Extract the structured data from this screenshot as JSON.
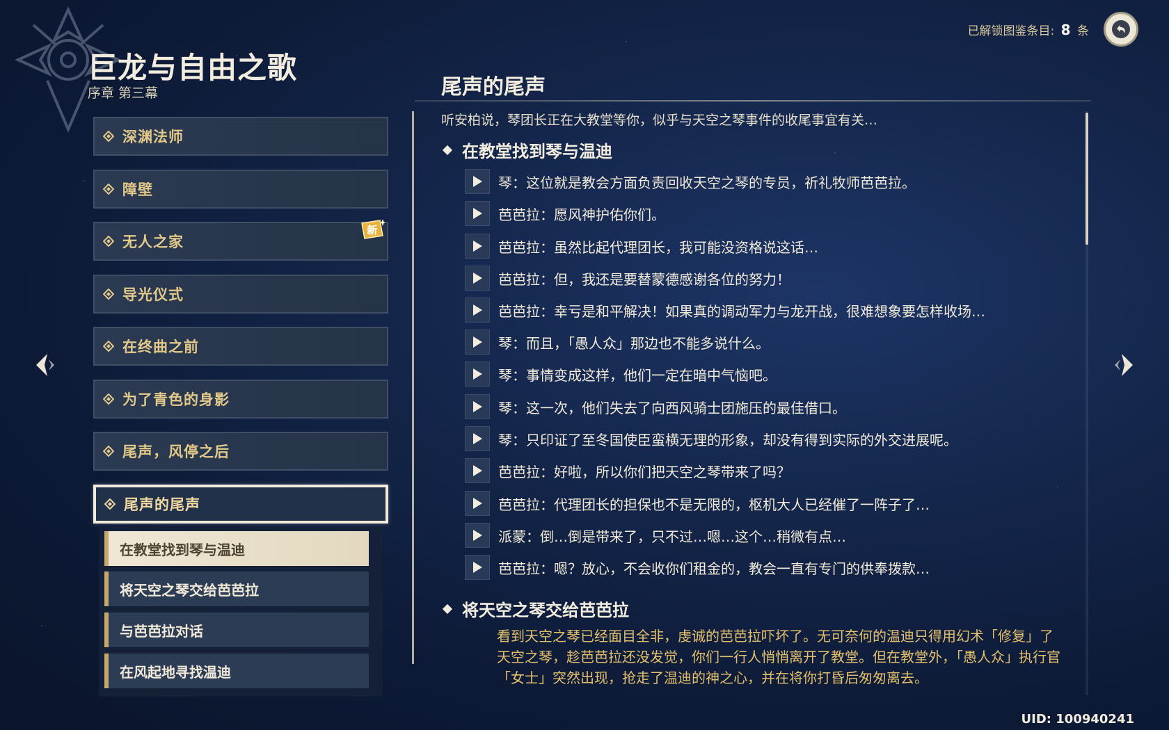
{
  "header": {
    "title": "巨龙与自由之歌",
    "subtitle": "序章 第三幕",
    "unlocked_label": "已解锁图鉴条目:",
    "unlocked_count": "8",
    "unlocked_unit": "条",
    "back_icon": "back-arrow-icon"
  },
  "chapters": [
    {
      "label": "深渊法师",
      "new": false,
      "active": false
    },
    {
      "label": "障壁",
      "new": false,
      "active": false
    },
    {
      "label": "无人之家",
      "new": true,
      "active": false
    },
    {
      "label": "导光仪式",
      "new": false,
      "active": false
    },
    {
      "label": "在终曲之前",
      "new": false,
      "active": false
    },
    {
      "label": "为了青色的身影",
      "new": false,
      "active": false
    },
    {
      "label": "尾声，风停之后",
      "new": false,
      "active": false
    },
    {
      "label": "尾声的尾声",
      "new": false,
      "active": true
    }
  ],
  "new_badge": "新",
  "sub_quests": [
    {
      "label": "在教堂找到琴与温迪",
      "selected": true
    },
    {
      "label": "将天空之琴交给芭芭拉",
      "selected": false
    },
    {
      "label": "与芭芭拉对话",
      "selected": false
    },
    {
      "label": "在风起地寻找温迪",
      "selected": false
    }
  ],
  "detail": {
    "title": "尾声的尾声",
    "intro": "听安柏说，琴团长正在大教堂等你，似乎与天空之琴事件的收尾事宜有关…",
    "sections": [
      {
        "heading": "在教堂找到琴与温迪",
        "lines": [
          "琴：这位就是教会方面负责回收天空之琴的专员，祈礼牧师芭芭拉。",
          "芭芭拉：愿风神护佑你们。",
          "芭芭拉：虽然比起代理团长，我可能没资格说这话…",
          "芭芭拉：但，我还是要替蒙德感谢各位的努力！",
          "芭芭拉：幸亏是和平解决！如果真的调动军力与龙开战，很难想象要怎样收场…",
          "琴：而且，「愚人众」那边也不能多说什么。",
          "琴：事情变成这样，他们一定在暗中气恼吧。",
          "琴：这一次，他们失去了向西风骑士团施压的最佳借口。",
          "琴：只印证了至冬国使臣蛮横无理的形象，却没有得到实际的外交进展呢。",
          "芭芭拉：好啦，所以你们把天空之琴带来了吗？",
          "芭芭拉：代理团长的担保也不是无限的，枢机大人已经催了一阵子了…",
          "派蒙：倒…倒是带来了，只不过…嗯…这个…稍微有点…",
          "芭芭拉：嗯？放心，不会收你们租金的，教会一直有专门的供奉拨款…"
        ]
      },
      {
        "heading": "将天空之琴交给芭芭拉",
        "summary_lines": [
          "看到天空之琴已经面目全非，虔诚的芭芭拉吓坏了。无可奈何的温迪只得用幻术「修复」了",
          "天空之琴，趁芭芭拉还没发觉，你们一行人悄悄离开了教堂。但在教堂外，「愚人众」执行官",
          "「女士」突然出现，抢走了温迪的神之心，并在将你打昏后匆匆离去。"
        ]
      }
    ]
  },
  "uid": "UID: 100940241"
}
